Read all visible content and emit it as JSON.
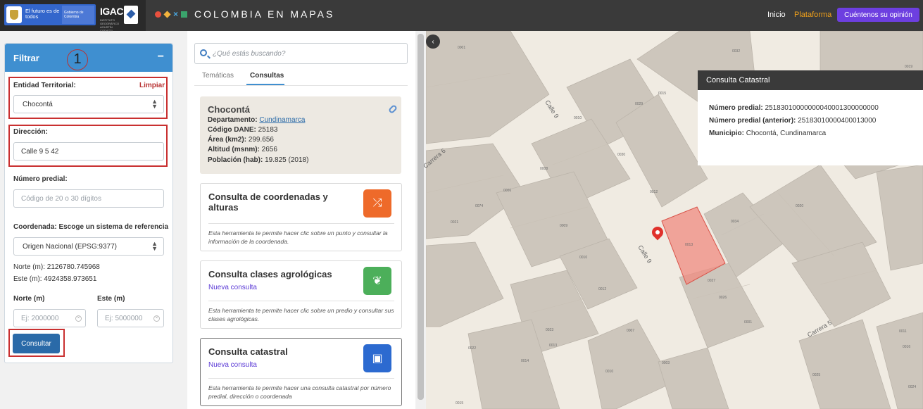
{
  "topbar": {
    "gov_text": "El futuro es de todos",
    "gov_sub": "Gobierno de Colombia",
    "igac": "IGAC",
    "igac_sub": "INSTITUTO GEOGRÁFICO AGUSTÍN CODAZZI",
    "brand_name": "COLOMBIA EN MAPAS",
    "nav": {
      "inicio": "Inicio",
      "plataforma": "Plataforma",
      "feedback_btn": "Cuéntenos su opinión"
    },
    "colors": {
      "bar": "#3a3a3a",
      "plataforma": "#f0a01a",
      "feedback": "#6d3fe0"
    }
  },
  "filter": {
    "title": "Filtrar",
    "collapse": "−",
    "step_number": "1",
    "entidad_label": "Entidad Territorial:",
    "limpiar": "Limpiar",
    "entidad_value": "Chocontá",
    "direccion_label": "Dirección:",
    "direccion_value": "Calle 9 5 42",
    "numero_label": "Número predial:",
    "numero_placeholder": "Código de 20 o 30 dígitos",
    "coord_label": "Coordenada: Escoge un sistema de referencia",
    "coord_system": "Origen Nacional (EPSG:9377)",
    "norte_text": "Norte (m): 2126780.745968",
    "este_text": "Este (m): 4924358.973651",
    "norte_label": "Norte (m)",
    "este_label": "Este (m)",
    "norte_placeholder": "Ej: 2000000",
    "este_placeholder": "Ej: 5000000",
    "consultar": "Consultar",
    "header_color": "#3f8fd0",
    "highlight_color": "#c93030"
  },
  "middle": {
    "search_placeholder": "¿Qué estás buscando?",
    "tabs": [
      {
        "label": "Temáticas"
      },
      {
        "label": "Consultas"
      }
    ],
    "municipio": {
      "name": "Chocontá",
      "depto_label": "Departamento:",
      "depto_value": "Cundinamarca",
      "dane_label": "Código DANE:",
      "dane_value": "25183",
      "area_label": "Área (km2):",
      "area_value": "299.656",
      "altitud_label": "Altitud (msnm):",
      "altitud_value": "2656",
      "poblacion_label": "Población (hab):",
      "poblacion_value": "19.825 (2018)"
    },
    "tools": [
      {
        "title": "Consulta de coordenadas y alturas",
        "subtitle": "",
        "desc": "Esta herramienta te permite hacer clic sobre un punto y consultar la información de la coordenada.",
        "icon": "shuffle-icon",
        "glyph": "⤮",
        "color": "#ee6a2a"
      },
      {
        "title": "Consulta clases agrológicas",
        "subtitle": "Nueva consulta",
        "desc": "Esta herramienta te permite hacer clic sobre un predio y consultar sus clases agrológicas.",
        "icon": "plant-icon",
        "glyph": "❦",
        "color": "#4caf5a"
      },
      {
        "title": "Consulta catastral",
        "subtitle": "Nueva consulta",
        "desc": "Esta herramienta te permite hacer una consulta catastral por número predial, dirección o coordenada",
        "icon": "layout-icon",
        "glyph": "▣",
        "color": "#2c6ad0"
      }
    ]
  },
  "map": {
    "toggle": "‹",
    "streets": [
      "Calle 9",
      "Carrera 6",
      "Calle 9",
      "Carrera 5"
    ],
    "lot_labels": [
      "0001",
      "0032",
      "0015",
      "0029",
      "0010",
      "0030",
      "0008",
      "0006",
      "0012",
      "0074",
      "0009",
      "0034",
      "0021",
      "0010",
      "0013",
      "0020",
      "0012",
      "0027",
      "0026",
      "0001",
      "0023",
      "0007",
      "0013",
      "0022",
      "0014",
      "0003",
      "0010",
      "0025",
      "0015",
      "0011",
      "0016",
      "0024",
      "0023",
      "0019"
    ],
    "popup": {
      "title": "Consulta Catastral",
      "numero_label": "Número predial:",
      "numero_value": "25183010000000040001300000000",
      "anterior_label": "Número predial (anterior):",
      "anterior_value": "25183010000400013000",
      "municipio_label": "Municipio:",
      "municipio_value": "Chocontá, Cundinamarca"
    },
    "colors": {
      "base": "#f0ebe2",
      "block": "#cdc6bc",
      "highlight": "#f08b80",
      "pin": "#e0312b"
    }
  }
}
